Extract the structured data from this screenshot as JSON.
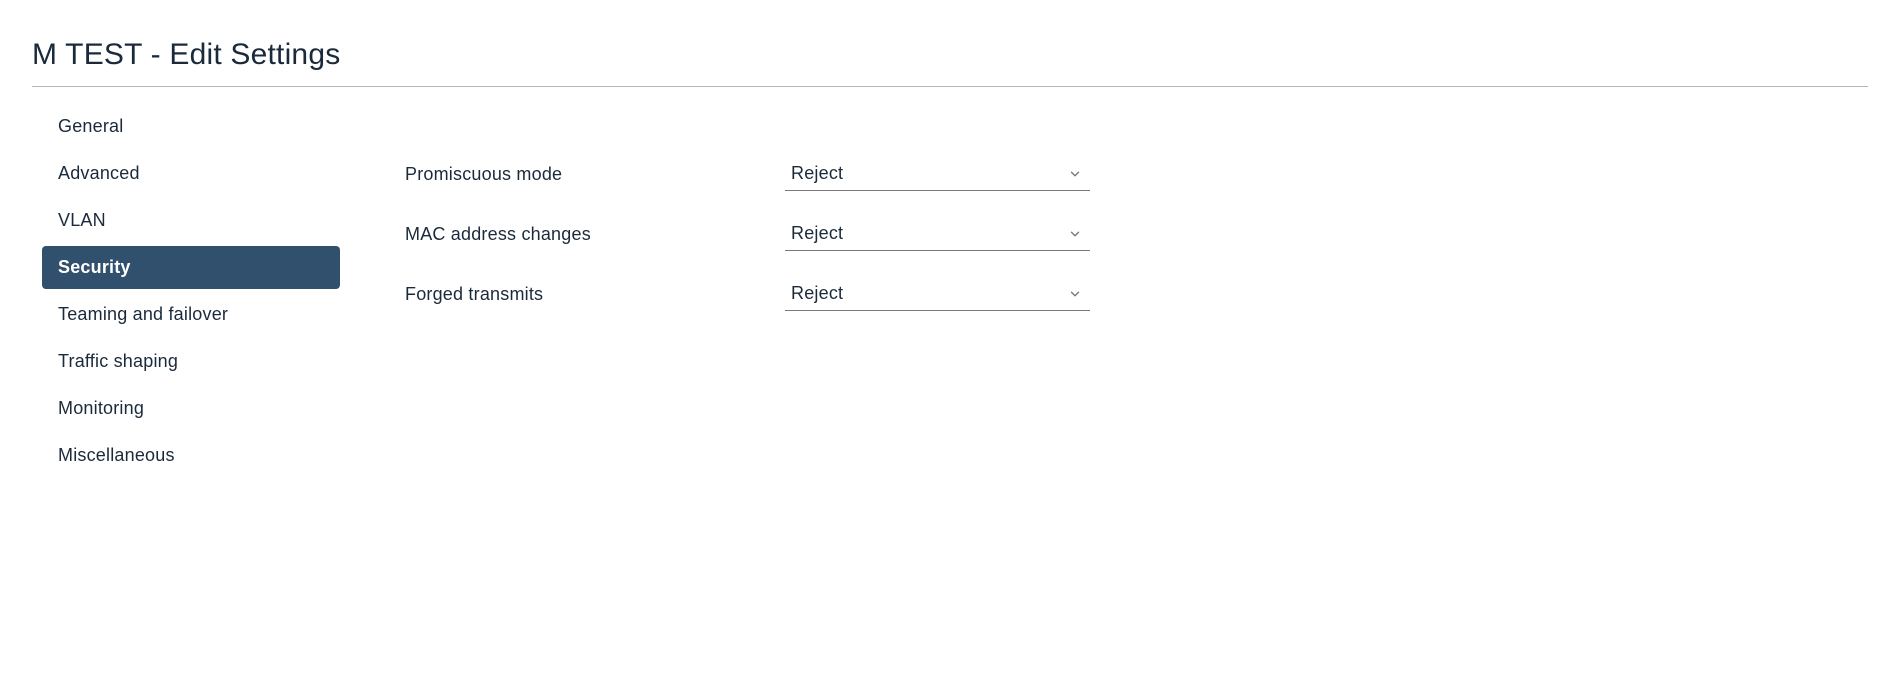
{
  "page_title": "M TEST - Edit Settings",
  "sidebar": {
    "items": [
      {
        "label": "General",
        "id": "general",
        "active": false
      },
      {
        "label": "Advanced",
        "id": "advanced",
        "active": false
      },
      {
        "label": "VLAN",
        "id": "vlan",
        "active": false
      },
      {
        "label": "Security",
        "id": "security",
        "active": true
      },
      {
        "label": "Teaming and failover",
        "id": "teaming-failover",
        "active": false
      },
      {
        "label": "Traffic shaping",
        "id": "traffic-shaping",
        "active": false
      },
      {
        "label": "Monitoring",
        "id": "monitoring",
        "active": false
      },
      {
        "label": "Miscellaneous",
        "id": "miscellaneous",
        "active": false
      }
    ]
  },
  "form": {
    "promiscuous_mode": {
      "label": "Promiscuous mode",
      "value": "Reject"
    },
    "mac_address_changes": {
      "label": "MAC address changes",
      "value": "Reject"
    },
    "forged_transmits": {
      "label": "Forged transmits",
      "value": "Reject"
    }
  }
}
